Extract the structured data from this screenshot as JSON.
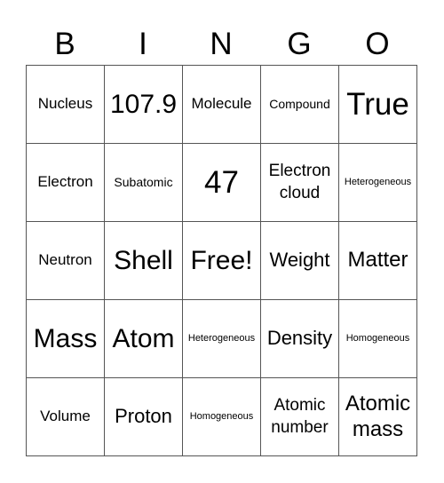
{
  "header": [
    "B",
    "I",
    "N",
    "G",
    "O"
  ],
  "cells": [
    {
      "text": "Nucleus",
      "size": "s-sm"
    },
    {
      "text": "107.9",
      "size": "s-lg"
    },
    {
      "text": "Molecule",
      "size": "s-sm"
    },
    {
      "text": "Compound",
      "size": "s-xs"
    },
    {
      "text": "True",
      "size": "s-xl"
    },
    {
      "text": "Electron",
      "size": "s-sm"
    },
    {
      "text": "Subatomic",
      "size": "s-xs"
    },
    {
      "text": "47",
      "size": "s-xl"
    },
    {
      "text": "Electron cloud",
      "size": "s-md"
    },
    {
      "text": "Heterogeneous",
      "size": "s-xxs"
    },
    {
      "text": "Neutron",
      "size": "s-sm"
    },
    {
      "text": "Shell",
      "size": "s-lg"
    },
    {
      "text": "Free!",
      "size": "s-lg"
    },
    {
      "text": "Weight",
      "size": "s-ml"
    },
    {
      "text": "Matter",
      "size": "s-md2"
    },
    {
      "text": "Mass",
      "size": "s-lg"
    },
    {
      "text": "Atom",
      "size": "s-lg"
    },
    {
      "text": "Heterogeneous",
      "size": "s-xxs"
    },
    {
      "text": "Density",
      "size": "s-ml"
    },
    {
      "text": "Homogeneous",
      "size": "s-xxs"
    },
    {
      "text": "Volume",
      "size": "s-sm"
    },
    {
      "text": "Proton",
      "size": "s-ml"
    },
    {
      "text": "Homogeneous",
      "size": "s-xxs"
    },
    {
      "text": "Atomic number",
      "size": "s-md"
    },
    {
      "text": "Atomic mass",
      "size": "s-md2"
    }
  ]
}
